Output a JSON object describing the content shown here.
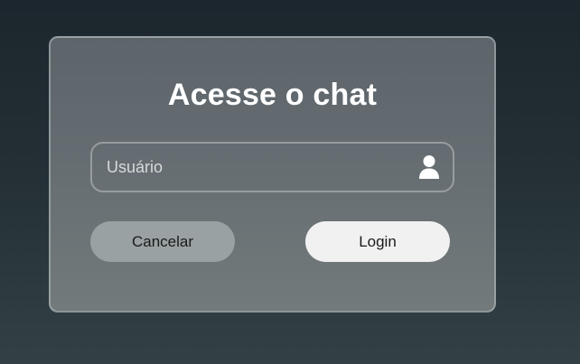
{
  "login_card": {
    "title": "Acesse o chat",
    "username_field": {
      "placeholder": "Usuário",
      "value": "",
      "icon": "user-icon"
    },
    "cancel_label": "Cancelar",
    "login_label": "Login"
  },
  "colors": {
    "background_top": "#1c262d",
    "background_bottom": "#334045",
    "card": "#646c71",
    "cancel_button": "#9aa1a3",
    "login_button": "#f1f1f1",
    "title_text": "#ffffff"
  }
}
